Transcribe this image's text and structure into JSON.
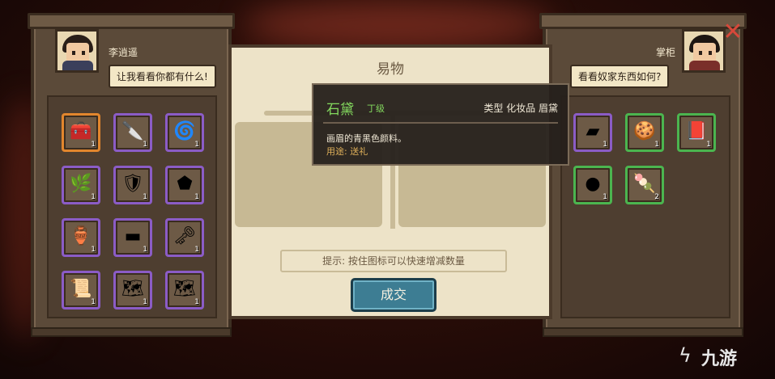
{
  "player": {
    "name": "李逍遥",
    "speech": "让我看看你都有什么!"
  },
  "merchant": {
    "name": "掌柜",
    "speech": "看看奴家东西如何?"
  },
  "trade_panel": {
    "title": "易物",
    "hint": "提示: 按住图标可以快速增减数量",
    "confirm_label": "成交"
  },
  "tooltip": {
    "item_name": "石黛",
    "grade": "丁级",
    "type_text": "类型  化妆品 眉黛",
    "description": "画眉的青黑色颜料。",
    "usage": "用途: 送礼"
  },
  "player_items": [
    {
      "icon": "treasure-chest-icon",
      "count": "1",
      "rarity": "gold"
    },
    {
      "icon": "cleaver-icon",
      "count": "1",
      "rarity": "purple"
    },
    {
      "icon": "jade-ornament-icon",
      "count": "1",
      "rarity": "purple"
    },
    {
      "icon": "ginseng-icon",
      "count": "1",
      "rarity": "purple"
    },
    {
      "icon": "armor-icon",
      "count": "1",
      "rarity": "purple"
    },
    {
      "icon": "iron-ore-icon",
      "count": "1",
      "rarity": "purple"
    },
    {
      "icon": "jar-icon",
      "count": "1",
      "rarity": "purple"
    },
    {
      "icon": "ink-stick-icon",
      "count": "1",
      "rarity": "purple"
    },
    {
      "icon": "key-icon",
      "count": "1",
      "rarity": "purple"
    },
    {
      "icon": "scroll-icon",
      "count": "1",
      "rarity": "purple"
    },
    {
      "icon": "map-icon",
      "count": "1",
      "rarity": "purple"
    },
    {
      "icon": "map-icon",
      "count": "1",
      "rarity": "purple"
    }
  ],
  "merchant_items": [
    {
      "icon": "eyebrow-ink-icon",
      "count": "1",
      "rarity": "purple"
    },
    {
      "icon": "rouge-box-icon",
      "count": "1",
      "rarity": "green"
    },
    {
      "icon": "book-icon",
      "count": "1",
      "rarity": "green"
    },
    {
      "icon": "powder-box-icon",
      "count": "1",
      "rarity": "green"
    },
    {
      "icon": "pastry-icon",
      "count": "2",
      "rarity": "green"
    }
  ],
  "watermark": "九游",
  "colors": {
    "rarity_purple": "#8b5cc6",
    "rarity_gold": "#e2862d",
    "rarity_green": "#4bb54f",
    "confirm_button": "#3d7d93",
    "item_name_green": "#83d85e"
  }
}
